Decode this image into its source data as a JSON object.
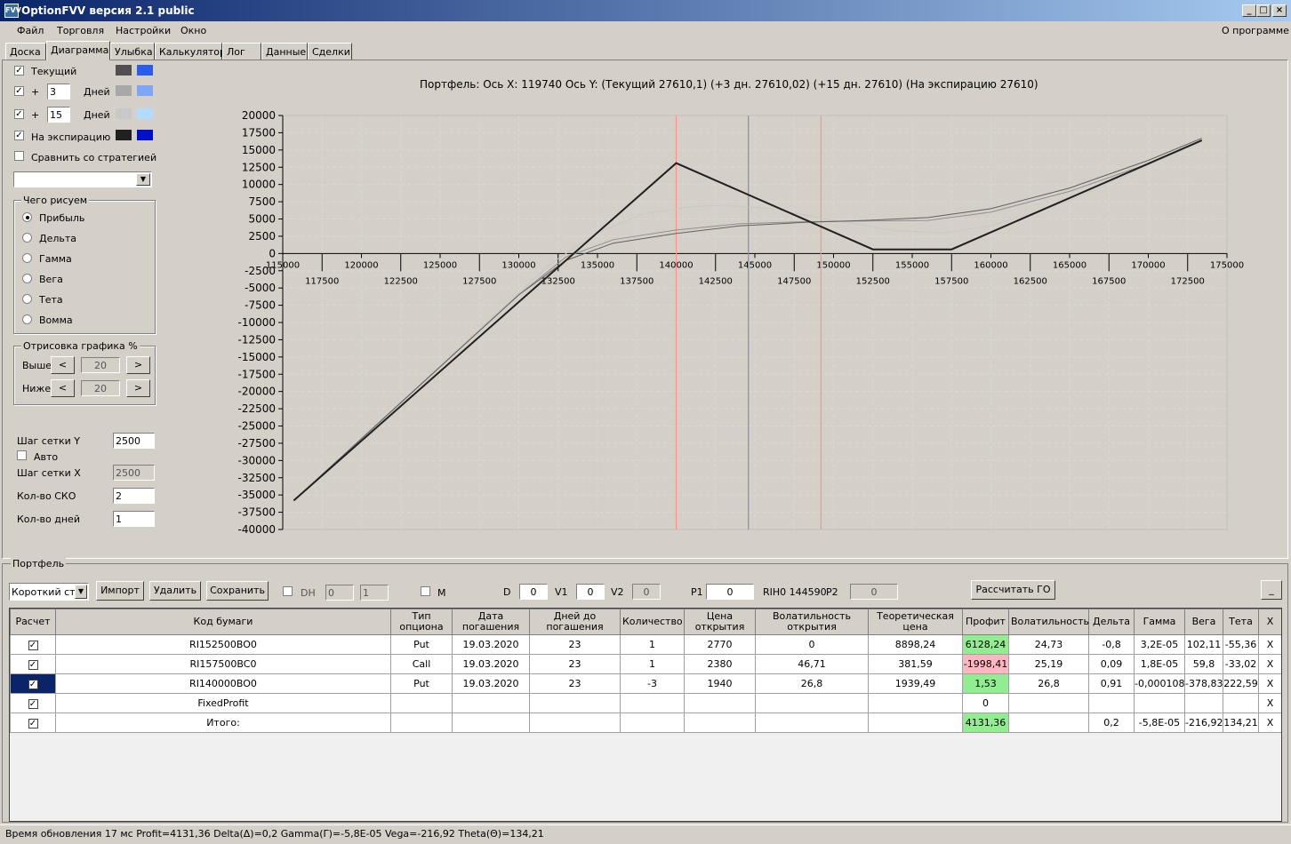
{
  "window": {
    "title": "OptionFVV версия 2.1 public"
  },
  "menu": {
    "items": [
      "Файл",
      "Торговля",
      "Настройки",
      "Окно"
    ],
    "about": "О программе"
  },
  "tabs": [
    "Доска",
    "Диаграмма",
    "Улыбка",
    "Калькулятор",
    "Лог",
    "Данные",
    "Сделки"
  ],
  "active_tab": "Диаграмма",
  "left_panel": {
    "curves": [
      {
        "label": "Текущий",
        "checked": true,
        "days": null,
        "color1": "#505050",
        "color2": "#2a5cf0"
      },
      {
        "label": "Дней",
        "checked": true,
        "days": "3",
        "color1": "#a8a8a8",
        "color2": "#7da7f5"
      },
      {
        "label": "Дней",
        "checked": true,
        "days": "15",
        "color1": "#c8c8c8",
        "color2": "#b0dcff"
      },
      {
        "label": "На экспирацию",
        "checked": true,
        "days": null,
        "color1": "#202020",
        "color2": "#0010c8"
      }
    ],
    "plus_sign": "+",
    "compare_label": "Сравнить со стратегией",
    "group_what": "Чего рисуем",
    "radios": [
      "Прибыль",
      "Дельта",
      "Гамма",
      "Вега",
      "Тета",
      "Вомма"
    ],
    "radio_selected": 0,
    "group_draw": "Отрисовка графика %",
    "above_label": "Выше",
    "above_value": "20",
    "below_label": "Ниже",
    "below_value": "20",
    "grid_y_label": "Шаг сетки Y",
    "grid_y_value": "2500",
    "auto_label": "Авто",
    "grid_x_label": "Шаг сетки X",
    "grid_x_value": "2500",
    "sko_label": "Кол-во СКО",
    "sko_value": "2",
    "days_label": "Кол-во дней",
    "days_value": "1"
  },
  "chart_data": {
    "type": "line",
    "title": "Портфель: Ось X:  119740 Ось Y:  (Текущий 27610,1)  (+3 дн. 27610,02)  (+15 дн. 27610)  (На экспирацию 27610)",
    "xlim": [
      115000,
      175000
    ],
    "ylim": [
      -40000,
      20000
    ],
    "x_ticks_top": [
      115000,
      120000,
      125000,
      130000,
      135000,
      140000,
      145000,
      150000,
      155000,
      160000,
      165000,
      170000,
      175000
    ],
    "x_ticks_bottom": [
      117500,
      122500,
      127500,
      132500,
      137500,
      142500,
      147500,
      152500,
      157500,
      162500,
      167500,
      172500
    ],
    "y_ticks": [
      20000,
      17500,
      15000,
      12500,
      10000,
      7500,
      5000,
      2500,
      0,
      -2500,
      -5000,
      -7500,
      -10000,
      -12500,
      -15000,
      -17500,
      -20000,
      -22500,
      -25000,
      -27500,
      -30000,
      -32500,
      -35000,
      -37500,
      -40000
    ],
    "vlines": [
      {
        "x": 140000,
        "color": "#ff9090"
      },
      {
        "x": 144590,
        "color": "#8090b0"
      },
      {
        "x": 149200,
        "color": "#ff9090"
      }
    ],
    "series": [
      {
        "color": "#202020",
        "width": 2,
        "points": [
          [
            115700,
            -35800
          ],
          [
            140000,
            13100
          ],
          [
            152500,
            600
          ],
          [
            157500,
            600
          ],
          [
            173400,
            16400
          ]
        ]
      },
      {
        "color": "#606060",
        "width": 1,
        "points": [
          [
            115700,
            -35800
          ],
          [
            130000,
            -6000
          ],
          [
            133000,
            -1000
          ],
          [
            136000,
            1500
          ],
          [
            140000,
            2900
          ],
          [
            144000,
            4000
          ],
          [
            148000,
            4500
          ],
          [
            152000,
            4800
          ],
          [
            156000,
            5200
          ],
          [
            160000,
            6500
          ],
          [
            165000,
            9500
          ],
          [
            170000,
            13500
          ],
          [
            173400,
            16700
          ]
        ]
      },
      {
        "color": "#909090",
        "width": 1,
        "points": [
          [
            115700,
            -35800
          ],
          [
            130000,
            -6000
          ],
          [
            133000,
            -500
          ],
          [
            136000,
            2000
          ],
          [
            140000,
            3400
          ],
          [
            144000,
            4300
          ],
          [
            148000,
            4600
          ],
          [
            152000,
            4700
          ],
          [
            156000,
            4800
          ],
          [
            160000,
            6000
          ],
          [
            165000,
            9000
          ],
          [
            170000,
            13000
          ],
          [
            173400,
            16500
          ]
        ]
      },
      {
        "color": "#c8c8c8",
        "width": 1,
        "points": [
          [
            115700,
            -35800
          ],
          [
            132000,
            -1500
          ],
          [
            135000,
            3000
          ],
          [
            138000,
            5800
          ],
          [
            141000,
            6800
          ],
          [
            143000,
            7000
          ],
          [
            146000,
            6500
          ],
          [
            150000,
            4800
          ],
          [
            154000,
            3300
          ],
          [
            157000,
            3000
          ],
          [
            160000,
            4000
          ],
          [
            165000,
            7600
          ],
          [
            170000,
            12800
          ],
          [
            173400,
            16200
          ]
        ]
      }
    ]
  },
  "portfolio": {
    "group_title": "Портфель",
    "strategy": "Короткий стр",
    "import_btn": "Импорт",
    "delete_btn": "Удалить",
    "save_btn": "Сохранить",
    "dh_label": "DH",
    "dh_value1": "0",
    "dh_value2": "1",
    "m_label": "M",
    "d_label": "D",
    "d_value": "0",
    "v1_label": "V1",
    "v1_value": "0",
    "v2_label": "V2",
    "v2_value": "0",
    "p1_label": "P1",
    "p1_value": "0",
    "rih_label": "RIH0 144590",
    "p2_label": "P2",
    "p2_value": "0",
    "calc_btn": "Рассчитать ГО",
    "minimize_btn": "_"
  },
  "table": {
    "headers": [
      "Расчет",
      "Код бумаги",
      "Тип опциона",
      "Дата погашения",
      "Дней до погашения",
      "Количество",
      "Цена открытия",
      "Волатильность открытия",
      "Теоретическая цена",
      "Профит",
      "Волатильность",
      "Дельта",
      "Гамма",
      "Вега",
      "Тета",
      "X"
    ],
    "rows": [
      {
        "cells": [
          "RI152500BO0",
          "Put",
          "19.03.2020",
          "23",
          "1",
          "2770",
          "0",
          "8898,24",
          "6128,24",
          "24,73",
          "-0,8",
          "3,2E-05",
          "102,11",
          "-55,36"
        ],
        "profit_color": "green",
        "selected": false
      },
      {
        "cells": [
          "RI157500BC0",
          "Call",
          "19.03.2020",
          "23",
          "1",
          "2380",
          "46,71",
          "381,59",
          "-1998,41",
          "25,19",
          "0,09",
          "1,8E-05",
          "59,8",
          "-33,02"
        ],
        "profit_color": "red",
        "selected": false
      },
      {
        "cells": [
          "RI140000BO0",
          "Put",
          "19.03.2020",
          "23",
          "-3",
          "1940",
          "26,8",
          "1939,49",
          "1,53",
          "26,8",
          "0,91",
          "-0,000108",
          "-378,83",
          "222,59"
        ],
        "profit_color": "green",
        "selected": true
      },
      {
        "cells": [
          "FixedProfit",
          "",
          "",
          "",
          "",
          "",
          "",
          "",
          "0",
          "",
          "",
          "",
          "",
          ""
        ],
        "profit_color": "",
        "selected": false
      },
      {
        "cells": [
          "Итого:",
          "",
          "",
          "",
          "",
          "",
          "",
          "",
          "4131,36",
          "",
          "0,2",
          "-5,8E-05",
          "-216,92",
          "134,21"
        ],
        "profit_color": "green",
        "selected": false
      }
    ],
    "delete_mark": "X",
    "check_mark": "✓"
  },
  "status": {
    "text": "Время обновления 17 мс  Profit=4131,36 Delta(Δ)=0,2 Gamma(Γ)=-5,8E-05 Vega=-216,92 Theta(Θ)=134,21"
  }
}
